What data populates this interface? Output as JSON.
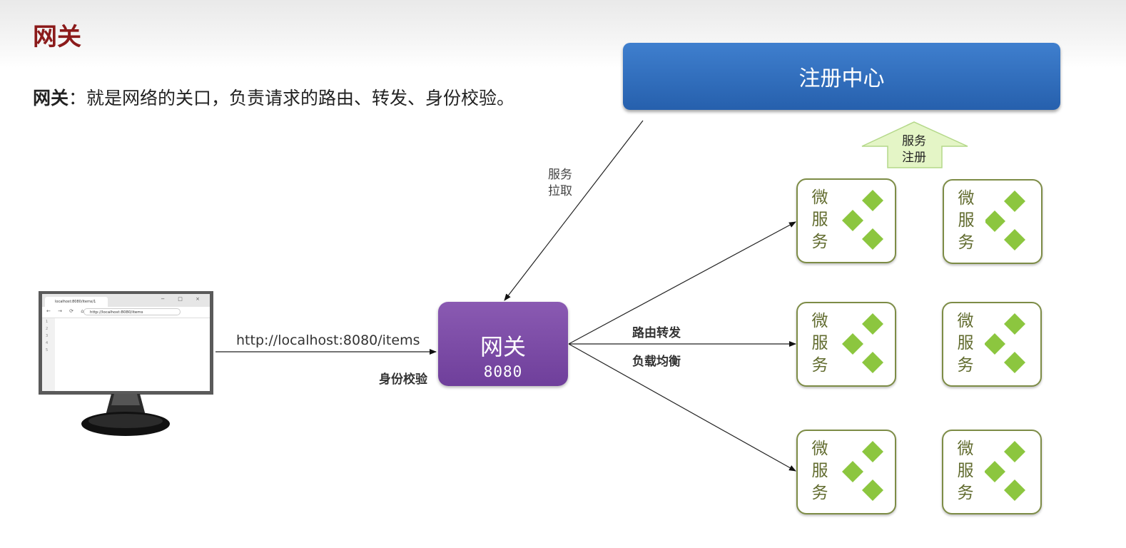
{
  "slide": {
    "title": "网关"
  },
  "definition": {
    "term": "网关",
    "text": "：就是网络的关口，负责请求的路由、转发、身份校验。"
  },
  "registry": {
    "label": "注册中心"
  },
  "gateway": {
    "name": "网关",
    "port": "8080"
  },
  "labels": {
    "request_url": "http://localhost:8080/items",
    "service_pull_line1": "服务",
    "service_pull_line2": "拉取",
    "routing": "路由转发",
    "load_balancing": "负载均衡",
    "auth": "身份校验",
    "service_register_line1": "服务",
    "service_register_line2": "注册"
  },
  "microservices": [
    {
      "line1": "微",
      "line2": "服",
      "line3": "务"
    },
    {
      "line1": "微",
      "line2": "服",
      "line3": "务"
    },
    {
      "line1": "微",
      "line2": "服",
      "line3": "务"
    },
    {
      "line1": "微",
      "line2": "服",
      "line3": "务"
    },
    {
      "line1": "微",
      "line2": "服",
      "line3": "务"
    },
    {
      "line1": "微",
      "line2": "服",
      "line3": "务"
    }
  ],
  "browser": {
    "tab_title": "localhost:8080/items/1",
    "address": "http://localhost:8080/items",
    "nav_icons": "← → ⟳ ⌂",
    "window_controls": "− □ ×",
    "line_numbers": [
      "1",
      "2",
      "3",
      "4",
      "5"
    ]
  },
  "colors": {
    "title": "#8b1a1a",
    "registry": "#2f6fbe",
    "gateway": "#7b4aa6",
    "microservice_border": "#7d8c46",
    "diamond": "#8cc63f",
    "register_arrow": "#e4f5c6"
  }
}
